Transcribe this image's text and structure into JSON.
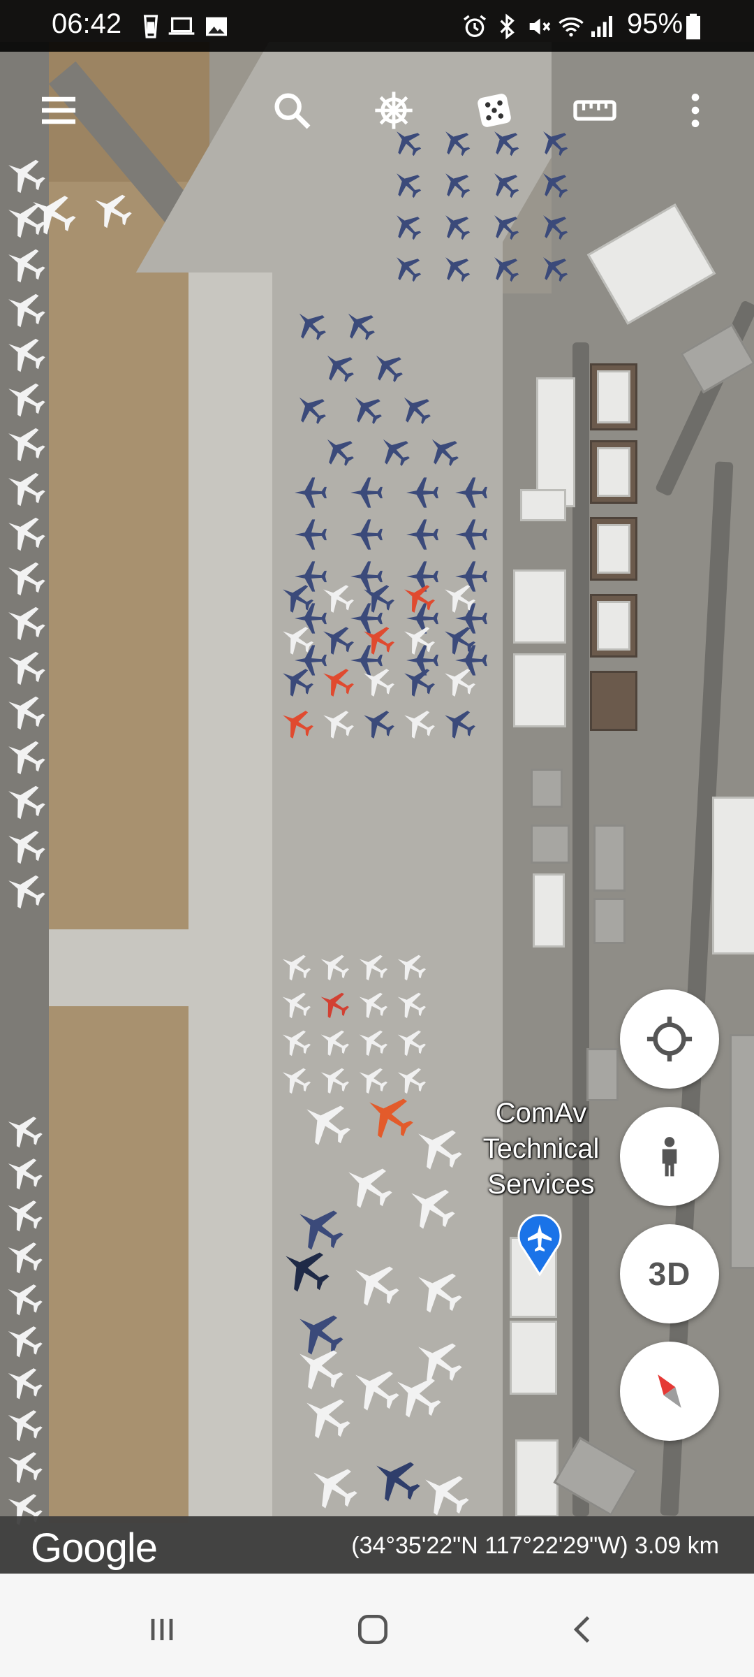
{
  "status_bar": {
    "time": "06:42",
    "battery_percent": "95%",
    "left_icons": [
      "trash-icon",
      "laptop-icon",
      "image-icon"
    ],
    "right_icons": [
      "alarm-icon",
      "bluetooth-icon",
      "mute-icon",
      "wifi-icon",
      "signal-icon",
      "battery-icon"
    ]
  },
  "toolbar": {
    "icons": [
      "menu-icon",
      "search-icon",
      "voyager-wheel-icon",
      "feeling-lucky-dice-icon",
      "measure-ruler-icon",
      "more-vert-icon"
    ]
  },
  "map": {
    "place_label_lines": [
      "ComAv",
      "Technical",
      "Services"
    ],
    "place_icon": "airport-pin-icon",
    "pin_color": "#1a73e8"
  },
  "fabs": {
    "my_location_icon": "my-location-icon",
    "pegman_icon": "pegman-icon",
    "threed_label": "3D",
    "compass_icon": "compass-icon"
  },
  "footer": {
    "logo_text": "Google",
    "coordinates": "(34°35'22\"N 117°22'29\"W) 3.09 km"
  },
  "nav_bar": {
    "icons": [
      "recent-apps-icon",
      "home-icon",
      "back-icon"
    ]
  }
}
